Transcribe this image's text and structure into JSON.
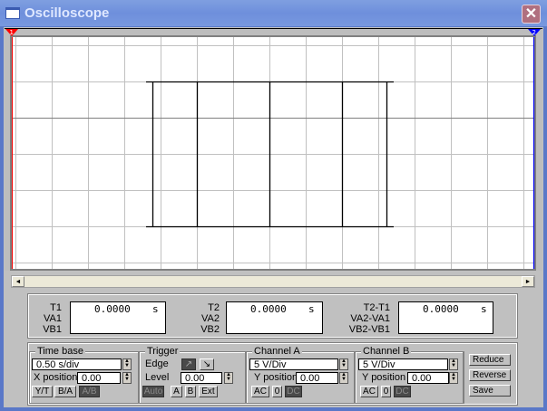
{
  "window": {
    "title": "Oscilloscope",
    "close": "✕"
  },
  "markers": {
    "cursor1": "1",
    "cursor2": "2",
    "cursor1_color": "#ff0000",
    "cursor2_color": "#0000ff"
  },
  "scrollbar": {
    "left": "◄",
    "right": "►"
  },
  "readouts": [
    {
      "labels": [
        "T1",
        "VA1",
        "VB1"
      ],
      "value": "0.0000",
      "unit": "s"
    },
    {
      "labels": [
        "T2",
        "VA2",
        "VB2"
      ],
      "value": "0.0000",
      "unit": "s"
    },
    {
      "labels": [
        "T2-T1",
        "VA2-VA1",
        "VB2-VB1"
      ],
      "value": "0.0000",
      "unit": "s"
    }
  ],
  "timebase": {
    "title": "Time base",
    "scale": "0.50 s/div",
    "xpos_label": "X position",
    "xpos": "0.00",
    "modes": [
      "Y/T",
      "B/A",
      "A/B"
    ],
    "active_mode": "A/B"
  },
  "trigger": {
    "title": "Trigger",
    "edge_label": "Edge",
    "rising": "↗",
    "falling": "↘",
    "level_label": "Level",
    "level": "0.00",
    "sources": [
      "Auto",
      "A",
      "B",
      "Ext"
    ],
    "active_source": "Auto"
  },
  "channel_a": {
    "title": "Channel A",
    "scale": "5 V/Div",
    "ypos_label": "Y position",
    "ypos": "0.00",
    "coupling": [
      "AC",
      "0",
      "DC"
    ],
    "active": "DC"
  },
  "channel_b": {
    "title": "Channel B",
    "scale": "5 V/Div",
    "ypos_label": "Y position",
    "ypos": "0.00",
    "coupling": [
      "AC",
      "0",
      "DC"
    ],
    "active": "DC"
  },
  "actions": {
    "reduce": "Reduce",
    "reverse": "Reverse",
    "save": "Save"
  },
  "colors": {
    "title_bar": "#7898df",
    "grid": "#c0c0c0",
    "trace": "#000000"
  }
}
